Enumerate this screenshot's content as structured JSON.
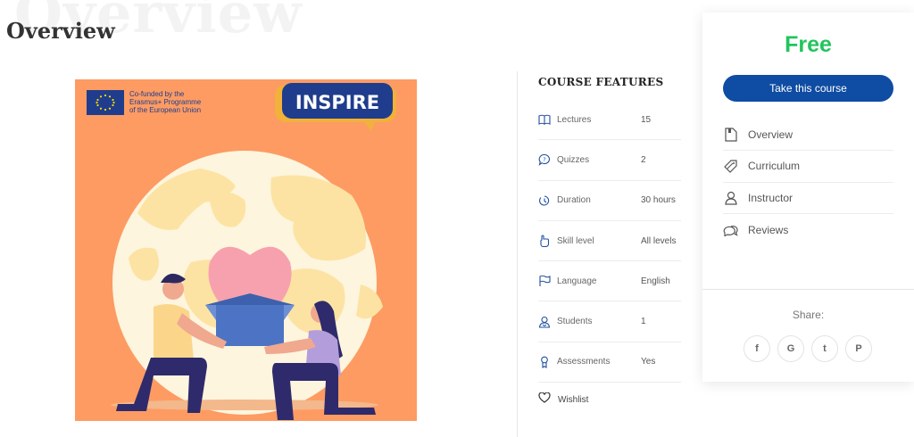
{
  "page": {
    "background_heading": "Overview",
    "title": "Overview"
  },
  "course_image": {
    "eu_lines": [
      "Co-funded by the",
      "Erasmus+ Programme",
      "of the European Union"
    ],
    "logo_text": "INSPIRE",
    "colors": {
      "background": "#fd9b63",
      "globe": "#fdf5dd",
      "land": "#fde3a3",
      "heart": "#f7a1ae",
      "box": "#4d74c4"
    }
  },
  "features": {
    "title": "COURSE FEATURES",
    "items": [
      {
        "icon": "book-icon",
        "label": "Lectures",
        "value": "15"
      },
      {
        "icon": "quiz-icon",
        "label": "Quizzes",
        "value": "2"
      },
      {
        "icon": "clock-icon",
        "label": "Duration",
        "value": "30 hours"
      },
      {
        "icon": "hand-icon",
        "label": "Skill level",
        "value": "All levels"
      },
      {
        "icon": "flag-icon",
        "label": "Language",
        "value": "English"
      },
      {
        "icon": "students-icon",
        "label": "Students",
        "value": "1"
      },
      {
        "icon": "badge-icon",
        "label": "Assessments",
        "value": "Yes"
      }
    ],
    "wishlist_label": "Wishlist"
  },
  "sidebar": {
    "price": "Free",
    "take_course_label": "Take this course",
    "nav": [
      {
        "icon": "document-icon",
        "label": "Overview"
      },
      {
        "icon": "tag-icon",
        "label": "Curriculum"
      },
      {
        "icon": "instructor-icon",
        "label": "Instructor"
      },
      {
        "icon": "chat-icon",
        "label": "Reviews"
      }
    ],
    "share_label": "Share:",
    "share_buttons": [
      {
        "icon": "facebook-icon",
        "glyph": "f"
      },
      {
        "icon": "google-icon",
        "glyph": "G"
      },
      {
        "icon": "twitter-icon",
        "glyph": "t"
      },
      {
        "icon": "pinterest-icon",
        "glyph": "P"
      }
    ],
    "colors": {
      "price": "#21c45d",
      "button": "#0f4ca3"
    }
  }
}
